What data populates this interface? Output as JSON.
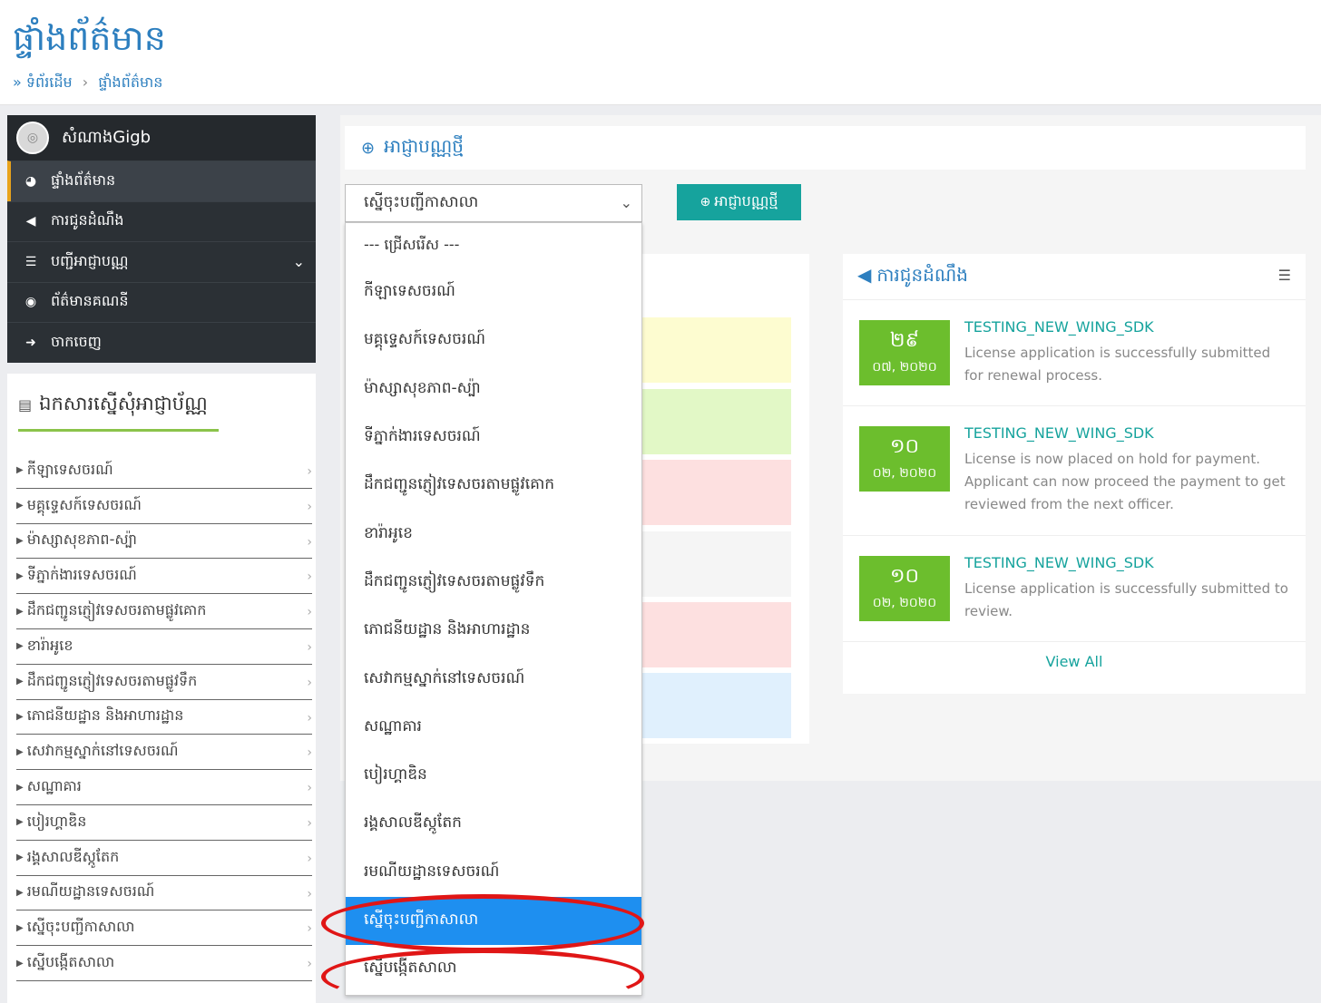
{
  "page": {
    "title": "ផ្ទាំងព័ត៌មាន",
    "breadcrumb": {
      "prefix": "»",
      "home": "ទំព័រដើម",
      "sep": "›",
      "current": "ផ្ទាំងព័ត៌មាន"
    }
  },
  "sidebar": {
    "profile_name": "សំណាងGigb",
    "items": [
      {
        "label": "ផ្ទាំងព័ត៌មាន",
        "icon": "dashboard-icon"
      },
      {
        "label": "ការជូនដំណឹង",
        "icon": "bullhorn-icon"
      },
      {
        "label": "បញ្ជីអាជ្ញាបណ្ណ",
        "icon": "list-icon"
      },
      {
        "label": "ព័ត៌មានគណនី",
        "icon": "user-circle-icon"
      },
      {
        "label": "ចាកចេញ",
        "icon": "sign-out-icon"
      }
    ]
  },
  "documents": {
    "title": "ឯកសារស្នើសុំអាជ្ញាប័ណ្ណ",
    "items": [
      "កីឡាទេសចរណ៍",
      "មគ្គុទ្ទេសក៍ទេសចរណ៍",
      "ម៉ាស្សាសុខភាព-ស្ប៉ា",
      "ទីភ្នាក់ងារទេសចរណ៍",
      "ដឹកជញ្ជូនភ្ញៀវទេសចរតាមផ្លូវគោក",
      "ខារ៉ាអូខេ",
      "ដឹកជញ្ជូនភ្ញៀវទេសចរតាមផ្លូវទឹក",
      "ភោជនីយដ្ឋាន និងអាហារដ្ឋាន",
      "សេវាកម្មស្នាក់នៅទេសចរណ៍",
      "សណ្ឋាគារ",
      "បៀរហ្គាឌិន",
      "រង្គសាលឌីស្កូតែក",
      "រមណីយដ្ឋានទេសចរណ៍",
      "ស្នើចុះបញ្ជីកាសាលា",
      "ស្នើបង្កើតសាលា"
    ]
  },
  "main": {
    "new_license_header": "អាជ្ញាបណ្ណថ្មី",
    "select_value": "ស្នើចុះបញ្ជីកាសាលា",
    "new_license_button": "អាជ្ញាបណ្ណថ្មី"
  },
  "dropdown": {
    "options": [
      "--- ជ្រើសរើស ---",
      "កីឡាទេសចរណ៍",
      "មគ្គុទ្ទេសក៍ទេសចរណ៍",
      "ម៉ាស្សាសុខភាព-ស្ប៉ា",
      "ទីភ្នាក់ងារទេសចរណ៍",
      "ដឹកជញ្ជូនភ្ញៀវទេសចរតាមផ្លូវគោក",
      "ខារ៉ាអូខេ",
      "ដឹកជញ្ជូនភ្ញៀវទេសចរតាមផ្លូវទឹក",
      "ភោជនីយដ្ឋាន និងអាហារដ្ឋាន",
      "សេវាកម្មស្នាក់នៅទេសចរណ៍",
      "សណ្ឋាគារ",
      "បៀរហ្គាឌិន",
      "រង្គសាលឌីស្កូតែក",
      "រមណីយដ្ឋានទេសចរណ៍",
      "ស្នើចុះបញ្ជីកាសាលា",
      "ស្នើបង្កើតសាលា"
    ],
    "selected_index": 14
  },
  "notifications": {
    "title": "ការជូនដំណឹង",
    "items": [
      {
        "day": "២៩",
        "month": "០៧, ២០២០",
        "title": "TESTING_NEW_WING_SDK",
        "text": "License application is successfully submitted for renewal process."
      },
      {
        "day": "១០",
        "month": "០២, ២០២០",
        "title": "TESTING_NEW_WING_SDK",
        "text": "License is now placed on hold for payment. Applicant can now proceed the payment to get reviewed from the next officer."
      },
      {
        "day": "១០",
        "month": "០២, ២០២០",
        "title": "TESTING_NEW_WING_SDK",
        "text": "License application is successfully submitted to review."
      }
    ],
    "view_all": "View All"
  },
  "colors": {
    "accent": "#2d7fbf",
    "teal": "#16a39d",
    "green": "#6cbe2d",
    "selected": "#1e8ff0",
    "annotation": "#e01616"
  }
}
